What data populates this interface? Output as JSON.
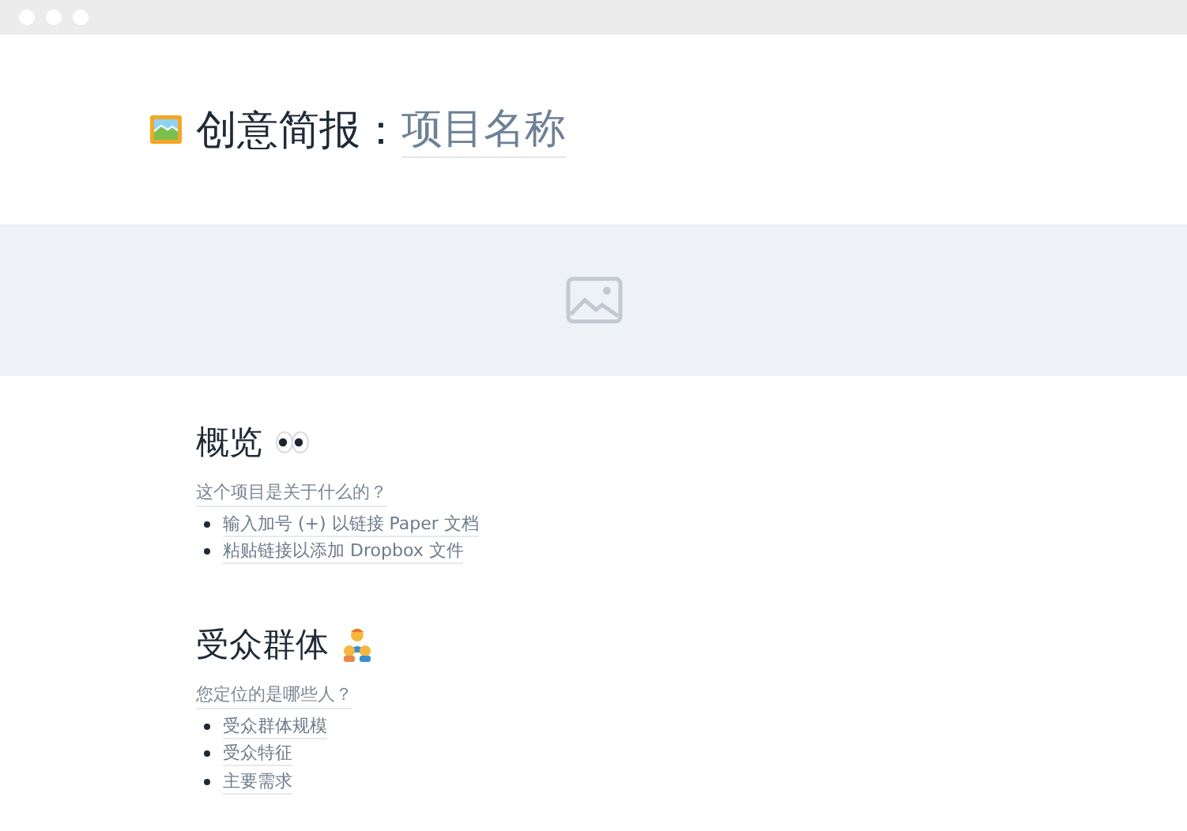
{
  "title": {
    "text": "创意简报：",
    "placeholder": "项目名称"
  },
  "sections": [
    {
      "heading": "概览",
      "kind": "eyes",
      "prompt": "这个项目是关于什么的？",
      "bullets": [
        "输入加号 (+) 以链接 Paper 文档",
        "粘贴链接以添加 Dropbox 文件"
      ]
    },
    {
      "heading": "受众群体",
      "kind": "family",
      "prompt": "您定位的是哪些人？",
      "bullets": [
        "受众群体规模",
        "受众特征",
        "主要需求"
      ]
    }
  ]
}
